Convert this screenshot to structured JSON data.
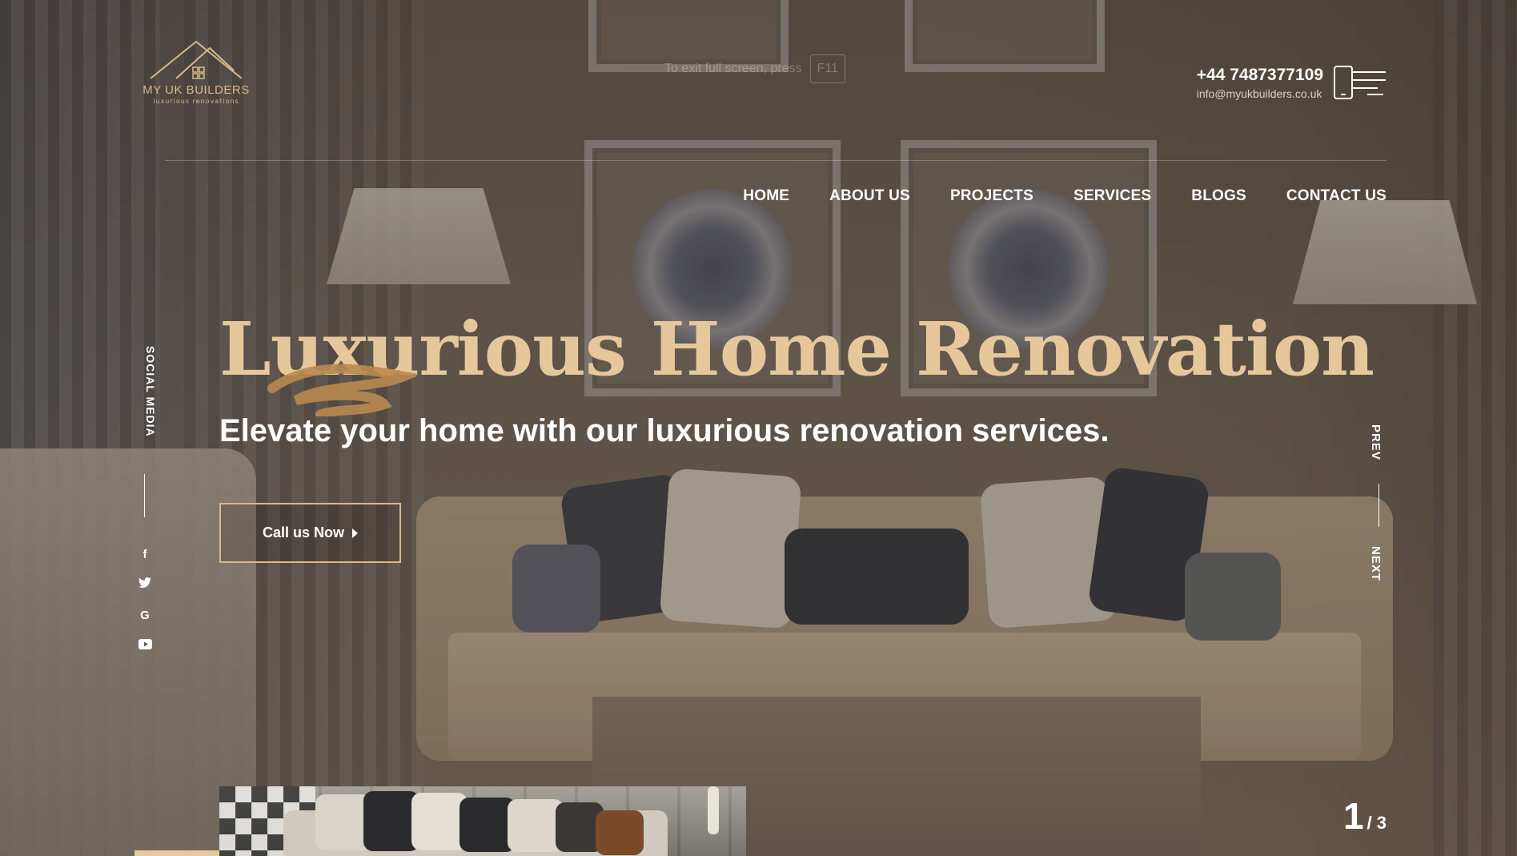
{
  "logo": {
    "brand": "MY UK BUILDERS",
    "tagline": "luxurious renovations"
  },
  "fullscreen_hint": {
    "text": "To exit full screen, press",
    "key": "F11"
  },
  "contact": {
    "phone": "+44 7487377109",
    "email": "info@myukbuilders.co.uk",
    "icon": "phone-menu-icon"
  },
  "nav": {
    "items": [
      {
        "label": "HOME"
      },
      {
        "label": "ABOUT US"
      },
      {
        "label": "PROJECTS"
      },
      {
        "label": "SERVICES"
      },
      {
        "label": "BLOGS"
      },
      {
        "label": "CONTACT US"
      }
    ]
  },
  "social": {
    "label": "SOCIAL MEDIA",
    "icons": [
      {
        "name": "facebook-icon",
        "glyph": "f"
      },
      {
        "name": "twitter-icon",
        "glyph": "🐦"
      },
      {
        "name": "google-icon",
        "glyph": "G"
      },
      {
        "name": "youtube-icon",
        "glyph": "▶"
      }
    ]
  },
  "hero": {
    "title": "Luxurious Home Renovation",
    "subtitle": "Elevate your home with our luxurious renovation services.",
    "cta_label": "Call us Now"
  },
  "slider": {
    "prev": "PREV",
    "next": "NEXT",
    "current": "1",
    "total": "/ 3"
  },
  "colors": {
    "accent_gold": "#e6c79c",
    "button_border": "#d9b98b",
    "text_white": "#ffffff"
  }
}
